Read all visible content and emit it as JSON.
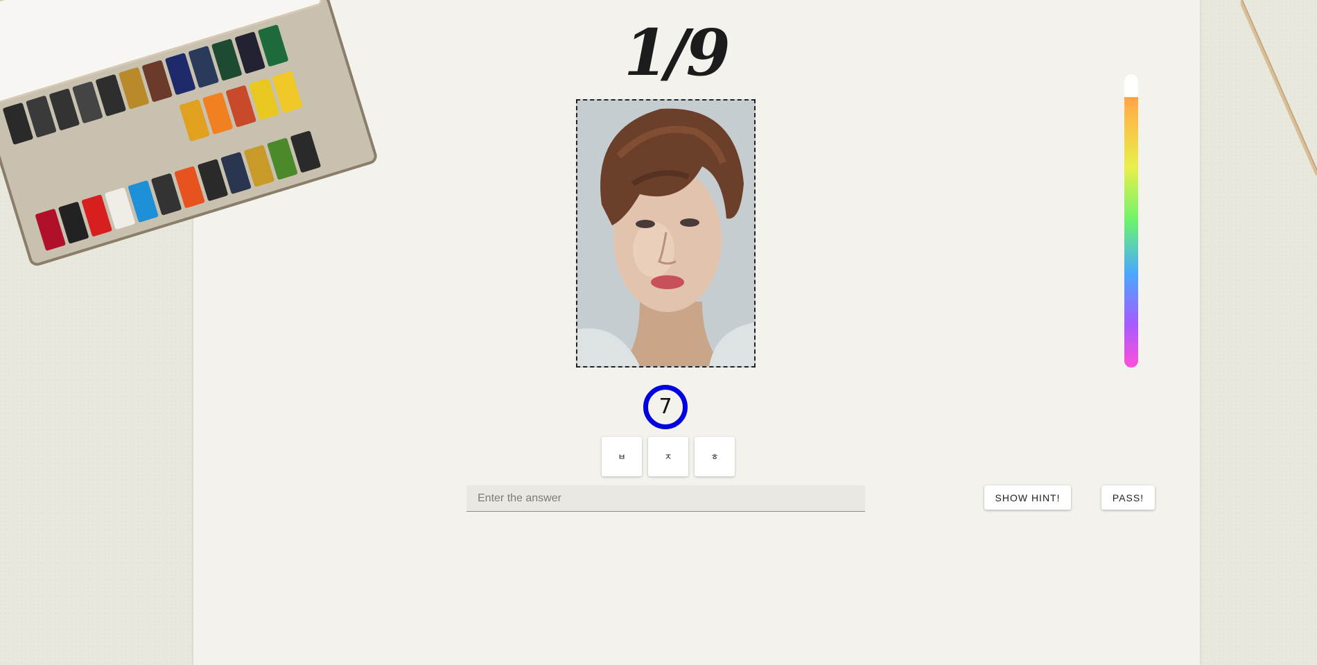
{
  "quiz": {
    "counter": "1/9",
    "timer": "7",
    "hint_letters": [
      "ㅂ",
      "ㅈ",
      "ㅎ"
    ],
    "answer": {
      "value": "",
      "placeholder": "Enter the answer"
    },
    "buttons": {
      "show_hint": "SHOW HINT!",
      "pass": "PASS!"
    },
    "meter_fill": 0.92
  },
  "colors": {
    "timer_ring": "#0000e0",
    "paper": "#f3f2ed",
    "background": "#e9e8dd"
  },
  "icons": {
    "portrait": "painted-portrait-image",
    "palette": "watercolor-palette-decoration",
    "brush": "paintbrush-decoration"
  }
}
